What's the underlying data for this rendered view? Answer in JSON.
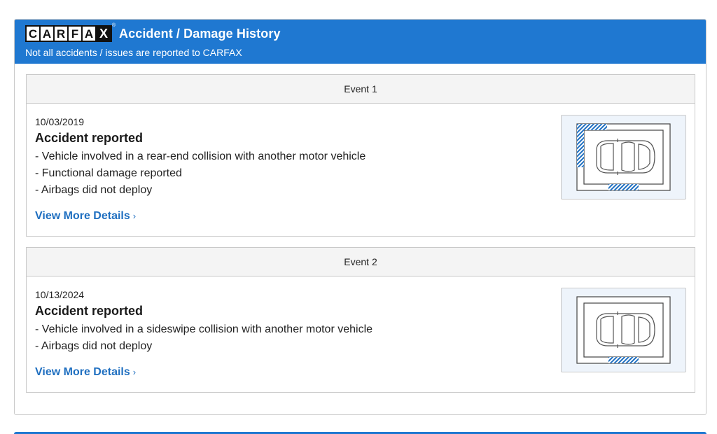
{
  "header": {
    "logo_letters": [
      "C",
      "A",
      "R",
      "F",
      "A",
      "X"
    ],
    "title": "Accident / Damage History",
    "subtitle": "Not all accidents / issues are reported to CARFAX"
  },
  "events": [
    {
      "label": "Event 1",
      "date": "10/03/2019",
      "type": "Accident reported",
      "lines": [
        "- Vehicle involved in a rear-end collision with another motor vehicle",
        "- Functional damage reported",
        "- Airbags did not deploy"
      ],
      "link": "View More Details",
      "damage_areas": [
        "left-rear",
        "rear"
      ]
    },
    {
      "label": "Event 2",
      "date": "10/13/2024",
      "type": "Accident reported",
      "lines": [
        "- Vehicle involved in a sideswipe collision with another motor vehicle",
        "- Airbags did not deploy"
      ],
      "link": "View More Details",
      "damage_areas": [
        "rear"
      ]
    }
  ],
  "colors": {
    "brand_blue": "#1f78d1",
    "link_blue": "#1f6fc0",
    "damage_hatch": "#1f6fc0"
  },
  "icons": {
    "chevron": "chevron-right-icon",
    "diagram": "car-damage-diagram-icon"
  }
}
